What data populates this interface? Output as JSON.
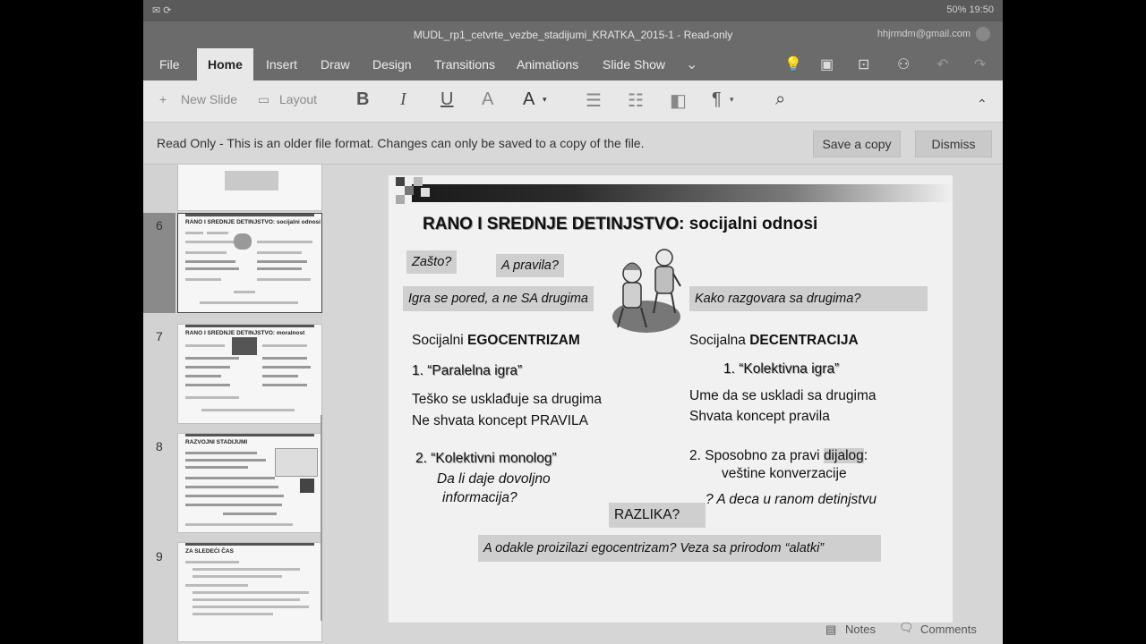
{
  "status_bar": {
    "left_icons": [
      "mail-icon",
      "sync-icon"
    ],
    "battery": "50%",
    "time": "19:50"
  },
  "window": {
    "title": "MUDL_rp1_cetvrte_vezbe_stadijumi_KRATKA_2015-1 - Read-only",
    "account": "hhjrmdm@gmail.com"
  },
  "ribbon": {
    "tabs": [
      "File",
      "Home",
      "Insert",
      "Draw",
      "Design",
      "Transitions",
      "Animations",
      "Slide Show"
    ],
    "active_tab": "Home"
  },
  "toolbar": {
    "new_slide": "New Slide",
    "layout": "Layout",
    "bold": "B",
    "italic": "I",
    "underline": "U",
    "font_a": "A",
    "font_color": "A"
  },
  "infobar": {
    "message": "Read Only - This is an older file format. Changes can only be saved to a copy of the file.",
    "save_copy": "Save a copy",
    "dismiss": "Dismiss"
  },
  "thumbnails": [
    {
      "number": "6",
      "title": "RANO I SREDNJE DETINJSTVO: socijalni odnosi"
    },
    {
      "number": "7",
      "title": "RANO I SREDNJE DETINJSTVO: moralnost"
    },
    {
      "number": "8",
      "title": "RAZVOJNI STADIJUMI"
    },
    {
      "number": "9",
      "title": "ZA SLEDEĆI ČAS"
    }
  ],
  "slide": {
    "title_bold": "RANO I SREDNJE DETINJSTVO",
    "title_rest": ": socijalni odnosi",
    "zasto": "Zašto?",
    "a_pravila": "A pravila?",
    "igra_se_pored": "Igra se pored, a ne SA drugima",
    "kako_razgovara": "Kako razgovara sa drugima?",
    "left": {
      "heading_prefix": "Socijalni ",
      "heading_bold": "EGOCENTRIZAM",
      "item1": "1. “Paralelna igra”",
      "line1": "Teško se usklađuje sa drugima",
      "line2": "Ne shvata koncept PRAVILA",
      "item2": "2. “Kolektivni monolog”",
      "note1": "Da li daje dovoljno",
      "note2": "informacija?"
    },
    "right": {
      "heading_prefix": "Socijalna ",
      "heading_bold": "DECENTRACIJA",
      "item1": "1. “Kolektivna igra”",
      "line1": "Ume da se uskladi sa drugima",
      "line2": "Shvata koncept pravila",
      "item2_prefix": "2. Sposobno za pravi ",
      "item2_highlight": "dijalog",
      "item2_suffix": ":",
      "line3": "veštine konverzacije",
      "question": "? A deca u ranom detinjstvu"
    },
    "razlika": "RAZLIKA?",
    "bottom_question": "A odakle proizilazi egocentrizam? Veza sa prirodom “alatki”"
  },
  "bottom": {
    "notes": "Notes",
    "comments": "Comments"
  }
}
